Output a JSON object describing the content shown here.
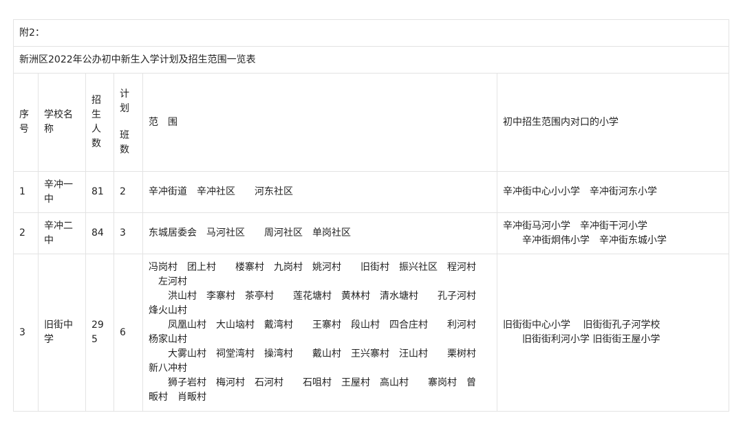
{
  "appendix_label": "附2：",
  "table_title": "新洲区2022年公办初中新生入学计划及招生范围一览表",
  "headers": {
    "index": "序号",
    "school": "学校名称",
    "enroll": "招生人数",
    "classes_top": "计划",
    "classes_bottom": "班数",
    "scope": "范　围",
    "primary": "初中招生范围内对口的小学"
  },
  "rows": [
    {
      "index": "1",
      "school": "辛冲一中",
      "enroll": "81",
      "classes": "2",
      "scope_lines": [
        "辛冲街道　辛冲社区　　河东社区"
      ],
      "primary_lines": [
        "辛冲街中心小小学　辛冲街河东小学"
      ]
    },
    {
      "index": "2",
      "school": "辛冲二中",
      "enroll": "84",
      "classes": "3",
      "scope_lines": [
        "东城居委会　马河社区　　周河社区　单岗社区"
      ],
      "primary_lines": [
        "辛冲街马河小学　辛冲街干河小学",
        "　　辛冲街炯伟小学　辛冲街东城小学"
      ]
    },
    {
      "index": "3",
      "school": "旧街中学",
      "enroll": "295",
      "classes": "6",
      "scope_lines": [
        "冯岗村　团上村　　楼寨村　九岗村　姚河村　　旧街村　振兴社区　程河村",
        "　左河村",
        "　　洪山村　李寨村　茶亭村　　莲花塘村　黄林村　清水塘村　　孔子河村",
        "烽火山村",
        "　　凤凰山村　大山垴村　戴湾村　　王寨村　段山村　四合庄村　　利河村",
        "杨家山村",
        "　　大雾山村　祠堂湾村　操湾村　　戴山村　王兴寨村　汪山村　　栗树村",
        "新八冲村",
        "　　狮子岩村　梅河村　石河村　　石咀村　王屋村　高山村　　寨岗村　曾",
        "畈村　肖畈村"
      ],
      "primary_lines": [
        "旧街街中心小学　 旧街街孔子河学校",
        "　　旧街街利河小学 旧街街王屋小学"
      ]
    }
  ]
}
